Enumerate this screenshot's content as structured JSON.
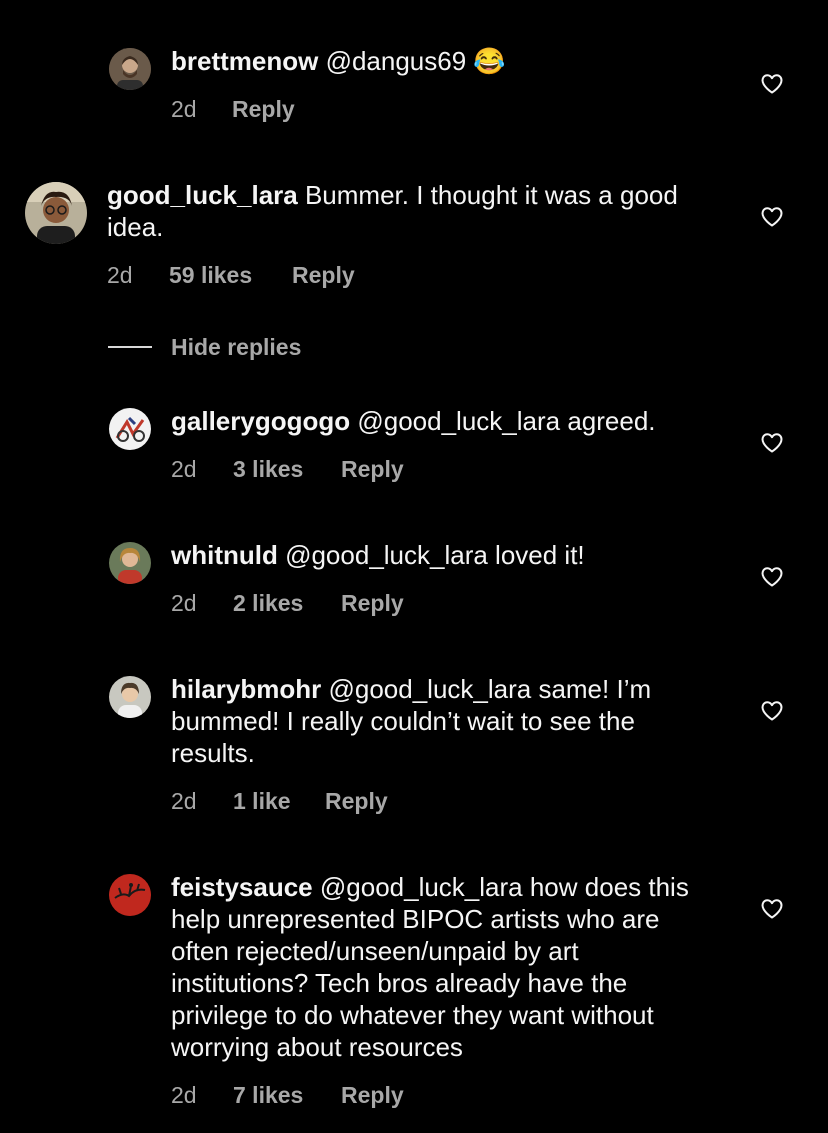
{
  "comments": [
    {
      "username": "brettmenow",
      "text": " @dangus69 😂",
      "time": "2d",
      "likes": "",
      "reply": "Reply"
    },
    {
      "username": "good_luck_lara",
      "text": " Bummer. I thought it was a good idea.",
      "time": "2d",
      "likes": "59 likes",
      "reply": "Reply"
    },
    {
      "username": "gallerygogogo",
      "text": " @good_luck_lara agreed.",
      "time": "2d",
      "likes": "3 likes",
      "reply": "Reply"
    },
    {
      "username": "whitnuld",
      "text": " @good_luck_lara loved it!",
      "time": "2d",
      "likes": "2 likes",
      "reply": "Reply"
    },
    {
      "username": "hilarybmohr",
      "text": " @good_luck_lara same! I’m bummed! I really couldn’t wait to see the results.",
      "time": "2d",
      "likes": "1 like",
      "reply": "Reply"
    },
    {
      "username": "feistysauce",
      "text": " @good_luck_lara how does this help unrepresented BIPOC artists who are often rejected/unseen/unpaid by art institutions? Tech bros already have the privilege to do whatever they want without worrying about resources",
      "time": "2d",
      "likes": "7 likes",
      "reply": "Reply"
    }
  ],
  "hide_replies": "Hide replies",
  "icons": {
    "like": "heart-outline-icon"
  },
  "colors": {
    "background": "#000000",
    "primary_text": "#f5f5f5",
    "secondary_text": "#a8a8a8"
  }
}
